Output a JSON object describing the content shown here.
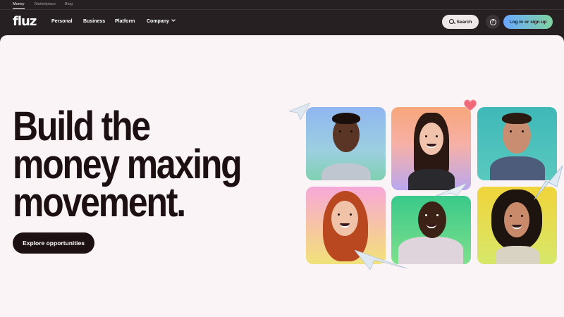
{
  "topbar": {
    "links": [
      "Money",
      "Marketplace",
      "Blog"
    ],
    "active": "Money"
  },
  "nav": {
    "logo": "fluz",
    "links": [
      "Personal",
      "Business",
      "Platform",
      "Company"
    ],
    "search_label": "Search",
    "help_icon": "?",
    "login_label": "Log in or sign up"
  },
  "hero": {
    "headline_lines": [
      "Build the",
      "money maxing",
      "movement."
    ],
    "cta_label": "Explore opportunities"
  },
  "colors": {
    "bar_bg": "#262022",
    "hero_bg": "#fbf4f6",
    "text_dark": "#1c1013",
    "login_gradient_start": "#6aa8ff",
    "login_gradient_end": "#7fd4a0"
  },
  "icons": [
    "search-icon",
    "question-circle-icon",
    "chevron-down-icon",
    "paper-plane-icon",
    "heart-balloon-icon"
  ]
}
